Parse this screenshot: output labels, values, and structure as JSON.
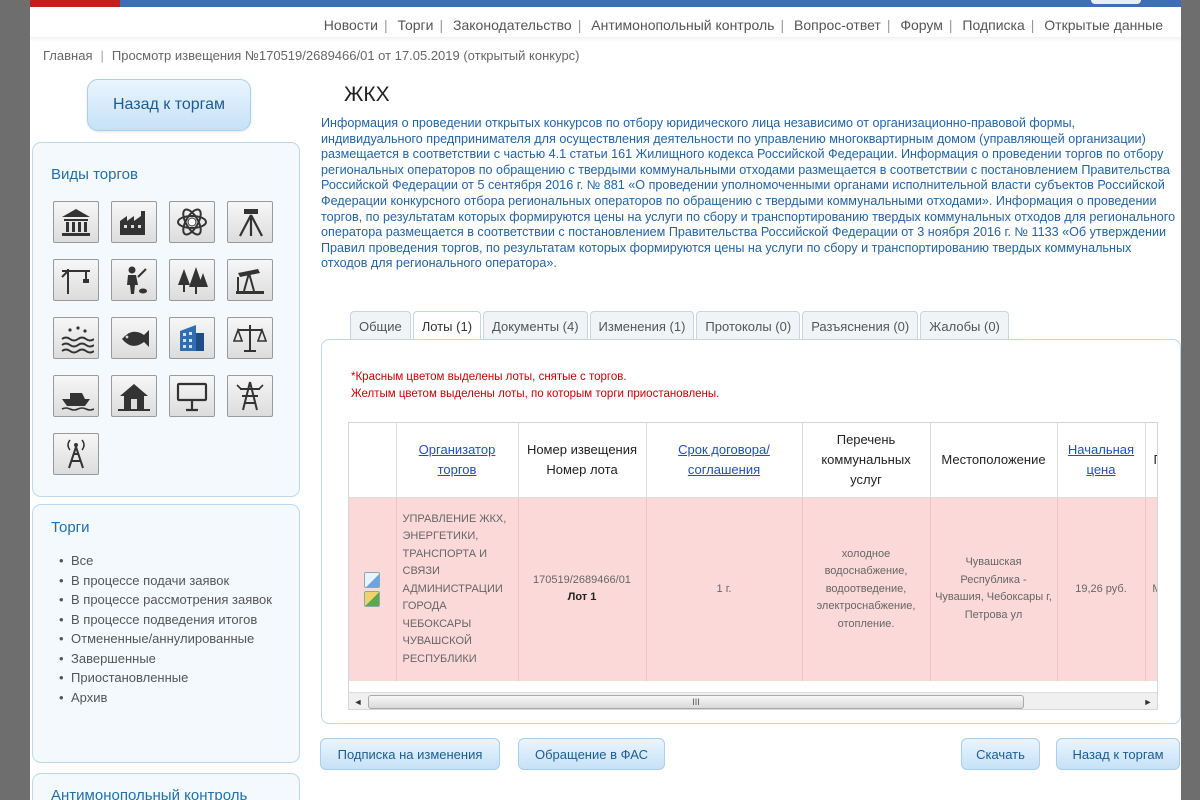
{
  "topnav": [
    "Новости",
    "Торги",
    "Законодательство",
    "Антимонопольный контроль",
    "Вопрос-ответ",
    "Форум",
    "Подписка",
    "Открытые данные"
  ],
  "breadcrumb": {
    "home": "Главная",
    "current": "Просмотр извещения №170519/2689466/01 от 17.05.2019 (открытый конкурс)"
  },
  "sidebar": {
    "back_button": "Назад к торгам",
    "vidy_title": "Виды торгов",
    "torgi_title": "Торги",
    "torgi_items": [
      "Все",
      "В процессе подачи заявок",
      "В процессе рассмотрения заявок",
      "В процессе подведения итогов",
      "Отмененные/аннулированные",
      "Завершенные",
      "Приостановленные",
      "Архив"
    ],
    "fas_title": "Антимонопольный контроль"
  },
  "main": {
    "title": "ЖКХ",
    "info": "Информация о проведении открытых конкурсов по отбору юридического лица независимо от организационно-правовой формы, индивидуального предпринимателя для осуществления деятельности по управлению многоквартирным домом (управляющей организации) размещается в соответствии с частью 4.1 статьи 161 Жилищного кодекса Российской Федерации. Информация о проведении торгов по отбору региональных операторов по обращению с твердыми коммунальными отходами размещается в соответствии с постановлением Правительства Российской Федерации от 5 сентября 2016 г. № 881 «О проведении уполномоченными органами исполнительной власти субъектов Российской Федерации конкурсного отбора региональных операторов по обращению с твердыми коммунальными отходами». Информация о проведении торгов, по результатам которых формируются цены на услуги по сбору и транспортированию твердых коммунальных отходов для регионального оператора размещается в соответствии с постановлением Правительства Российской Федерации от 3 ноября 2016 г. № 1133 «Об утверждении Правил проведения торгов, по результатам которых формируются цены на услуги по сбору и транспортированию твердых коммунальных отходов для регионального оператора».",
    "tabs": [
      "Общие",
      "Лоты (1)",
      "Документы (4)",
      "Изменения (1)",
      "Протоколы (0)",
      "Разъяснения (0)",
      "Жалобы (0)"
    ],
    "note_red": "*Красным цветом выделены лоты, снятые с торгов.",
    "note_yellow": "Желтым цветом выделены лоты, по которым торги приостановлены.",
    "columns": {
      "org": "Организатор торгов",
      "notice": "Номер извещения Номер лота",
      "term": "Срок договора/соглашения",
      "services": "Перечень коммунальных услуг",
      "location": "Местоположение",
      "price": "Начальная цена",
      "cut": "Г"
    },
    "row": {
      "org": "УПРАВЛЕНИЕ ЖКХ, ЭНЕРГЕТИКИ, ТРАНСПОРТА И СВЯЗИ АДМИНИСТРАЦИИ ГОРОДА ЧЕБОКСАРЫ ЧУВАШСКОЙ РЕСПУБЛИКИ",
      "notice": "170519/2689466/01",
      "lot": "Лот 1",
      "term": "1 г.",
      "services": "холодное водоснабжение, водоотведение, электроснабжение, отопление.",
      "location": "Чувашская Республика - Чувашия, Чебоксары г, Петрова ул",
      "price": "19,26 руб.",
      "cut": "М"
    },
    "scroll_thumb": "III"
  },
  "buttons": {
    "subscribe": "Подписка на изменения",
    "fas": "Обращение в ФАС",
    "download": "Скачать",
    "back": "Назад к торгам"
  },
  "colors": {
    "accent": "#1f6fb3",
    "row_removed": "#fbd9d9",
    "link": "#1f4fbf"
  }
}
